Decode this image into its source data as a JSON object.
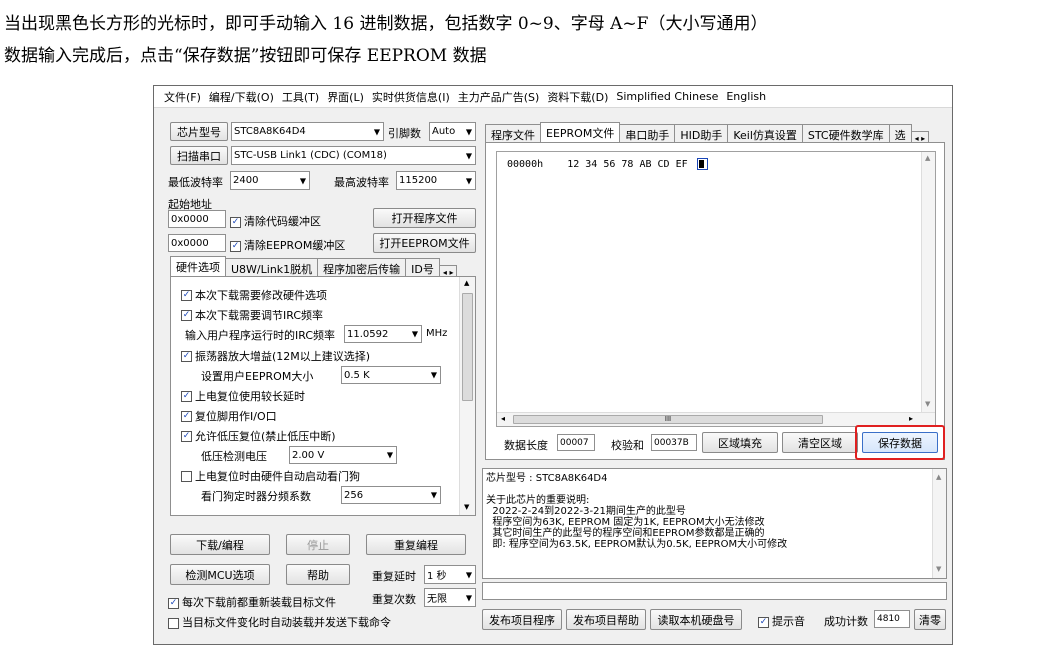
{
  "doc": {
    "line1": "当出现黑色长方形的光标时，即可手动输入 16 进制数据，包括数字 0~9、字母 A~F（大小写通用）",
    "line2": "数据输入完成后，点击“保存数据”按钮即可保存 EEPROM 数据"
  },
  "menu": [
    "文件(F)",
    "编程/下载(O)",
    "工具(T)",
    "界面(L)",
    "实时供货信息(I)",
    "主力产品广告(S)",
    "资料下载(D)",
    "Simplified Chinese",
    "English"
  ],
  "left": {
    "chip_btn": "芯片型号",
    "chip_value": "STC8A8K64D4",
    "pins_label": "引脚数",
    "pins_value": "Auto",
    "scan_btn": "扫描串口",
    "port_value": "STC-USB Link1 (CDC) (COM18)",
    "min_baud_label": "最低波特率",
    "min_baud": "2400",
    "max_baud_label": "最高波特率",
    "max_baud": "115200",
    "start_addr_label": "起始地址",
    "addr1": "0x0000",
    "clear_code": "清除代码缓冲区",
    "open_prog": "打开程序文件",
    "addr2": "0x0000",
    "clear_eeprom": "清除EEPROM缓冲区",
    "open_eeprom": "打开EEPROM文件",
    "tabs": [
      "硬件选项",
      "U8W/Link1脱机",
      "程序加密后传输",
      "ID号"
    ],
    "opts": {
      "o1": "本次下载需要修改硬件选项",
      "o2": "本次下载需要调节IRC频率",
      "irc_label": "输入用户程序运行时的IRC频率",
      "irc_value": "11.0592",
      "irc_unit": "MHz",
      "o3": "振荡器放大增益(12M以上建议选择)",
      "eeprom_size_label": "设置用户EEPROM大小",
      "eeprom_size": "0.5 K",
      "o4": "上电复位使用较长延时",
      "o5": "复位脚用作I/O口",
      "o6": "允许低压复位(禁止低压中断)",
      "lv_label": "低压检测电压",
      "lv_value": "2.00 V",
      "o7": "上电复位时由硬件自动启动看门狗",
      "wdt_label": "看门狗定时器分频系数",
      "wdt_value": "256"
    },
    "download_btn": "下载/编程",
    "stop_btn": "停止",
    "reprogram_btn": "重复编程",
    "detect_btn": "检测MCU选项",
    "help_btn": "帮助",
    "delay_label": "重复延时",
    "delay_value": "1 秒",
    "count_label": "重复次数",
    "count_value": "无限",
    "reload_chk": "每次下载前都重新装载目标文件",
    "auto_chk": "当目标文件变化时自动装载并发送下载命令"
  },
  "right": {
    "tabs": [
      "程序文件",
      "EEPROM文件",
      "串口助手",
      "HID助手",
      "Keil仿真设置",
      "STC硬件数学库",
      "选"
    ],
    "hex_addr": "00000h",
    "hex_bytes": "12 34 56 78 AB CD EF",
    "hscroll_mid": "III",
    "len_label": "数据长度",
    "len_value": "00007",
    "chk_label": "校验和",
    "chk_value": "00037B",
    "fill_btn": "区域填充",
    "clear_btn": "清空区域",
    "save_btn": "保存数据",
    "info": "芯片型号 : STC8A8K64D4\n\n关于此芯片的重要说明:\n  2022-2-24到2022-3-21期间生产的此型号\n  程序空间为63K, EEPROM 固定为1K, EEPROM大小无法修改\n  其它时间生产的此型号的程序空间和EEPROM参数都是正确的\n  即: 程序空间为63.5K, EEPROM默认为0.5K, EEPROM大小可修改",
    "publish_btn": "发布项目程序",
    "publish_help_btn": "发布项目帮助",
    "read_disk_btn": "读取本机硬盘号",
    "sound_chk": "提示音",
    "success_label": "成功计数",
    "success_value": "4810",
    "clear_count_btn": "清零"
  }
}
